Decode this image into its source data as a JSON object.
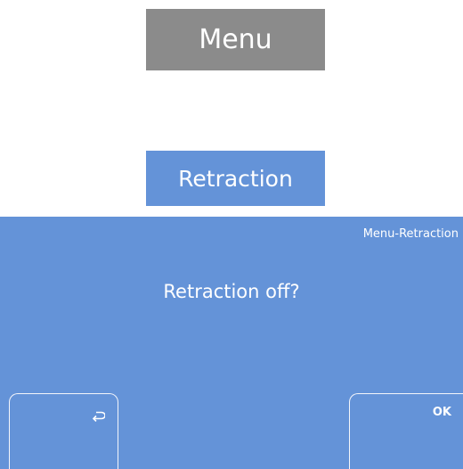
{
  "title_button": {
    "label": "Menu"
  },
  "section_button": {
    "label": "Retraction"
  },
  "dialog": {
    "breadcrumb": "Menu-Retraction",
    "question": "Retraction off?",
    "back_button": {
      "icon": "return-arrow-icon"
    },
    "ok_button": {
      "label": "OK"
    }
  },
  "colors": {
    "menu_gray": "#8b8b8b",
    "panel_blue": "#6493d8",
    "text": "#ffffff"
  }
}
